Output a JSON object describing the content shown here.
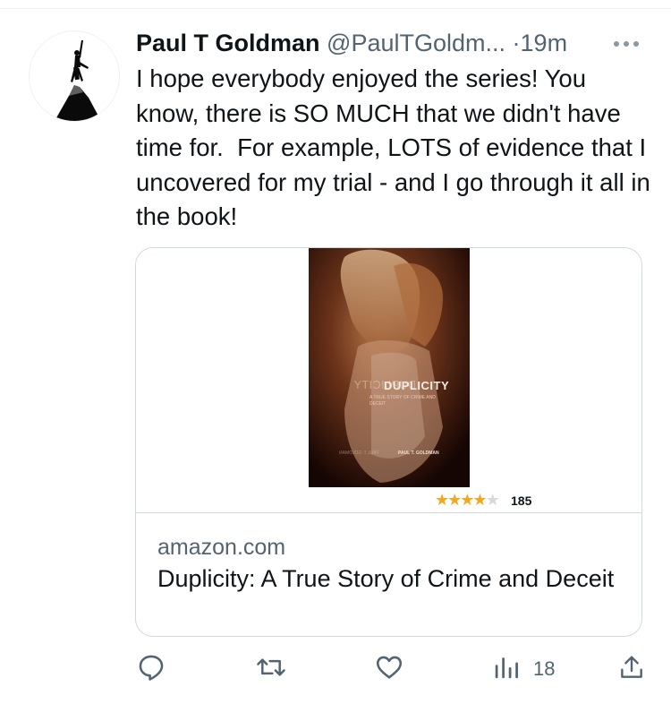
{
  "tweet": {
    "author": {
      "name": "Paul T Goldman",
      "handle": "@PaulTGoldm...",
      "avatar_icon": "mountain-silhouette-avatar"
    },
    "separator": "·",
    "time": "19m",
    "text": "I hope everybody enjoyed the series! You know, there is SO MUCH that we didn't have time for.  For example, LOTS of evidence that I uncovered for my trial - and I go through it all in the book!",
    "card": {
      "cover": {
        "title": "DUPLICITY",
        "title_mirrored": "DUPLICITY",
        "subtitle": "A TRUE STORY OF CRIME AND DECEIT",
        "author": "PAUL T. GOLDMAN",
        "author_mirrored": "PAUL T. GOLDMAN"
      },
      "rating": {
        "stars_filled": 4,
        "stars_total": 5,
        "count": "185"
      },
      "domain": "amazon.com",
      "title": "Duplicity: A True Story of Crime and Deceit"
    },
    "actions": {
      "reply_icon": "reply-icon",
      "retweet_icon": "retweet-icon",
      "like_icon": "like-icon",
      "views_icon": "views-icon",
      "views_count": "18",
      "share_icon": "share-icon"
    }
  },
  "colors": {
    "text_primary": "#0f1419",
    "text_secondary": "#536471",
    "border": "#cfd9de",
    "star": "#f3a81e"
  }
}
